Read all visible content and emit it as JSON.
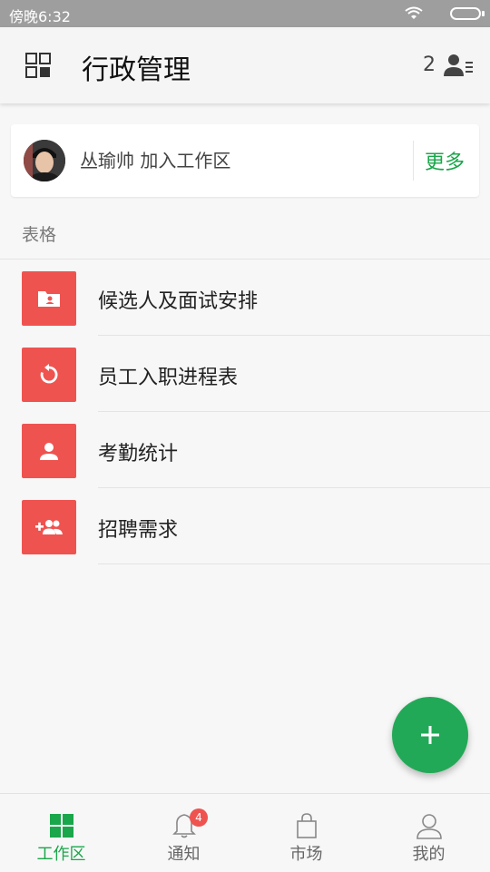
{
  "status_bar": {
    "time": "傍晚6:32"
  },
  "app_bar": {
    "title": "行政管理",
    "member_count": "2"
  },
  "join_card": {
    "text": "丛瑜帅 加入工作区",
    "more_label": "更多"
  },
  "section": {
    "label": "表格"
  },
  "list": [
    {
      "label": "候选人及面试安排",
      "icon": "folder-person-icon"
    },
    {
      "label": "员工入职进程表",
      "icon": "refresh-icon"
    },
    {
      "label": "考勤统计",
      "icon": "person-icon"
    },
    {
      "label": "招聘需求",
      "icon": "add-group-icon"
    }
  ],
  "bottom_nav": [
    {
      "label": "工作区",
      "icon": "grid-icon",
      "active": true
    },
    {
      "label": "通知",
      "icon": "bell-icon",
      "badge": "4"
    },
    {
      "label": "市场",
      "icon": "bag-icon"
    },
    {
      "label": "我的",
      "icon": "user-icon"
    }
  ],
  "colors": {
    "accent": "#1aa64a",
    "list_icon_bg": "#ef5350",
    "fab": "#22a957"
  }
}
